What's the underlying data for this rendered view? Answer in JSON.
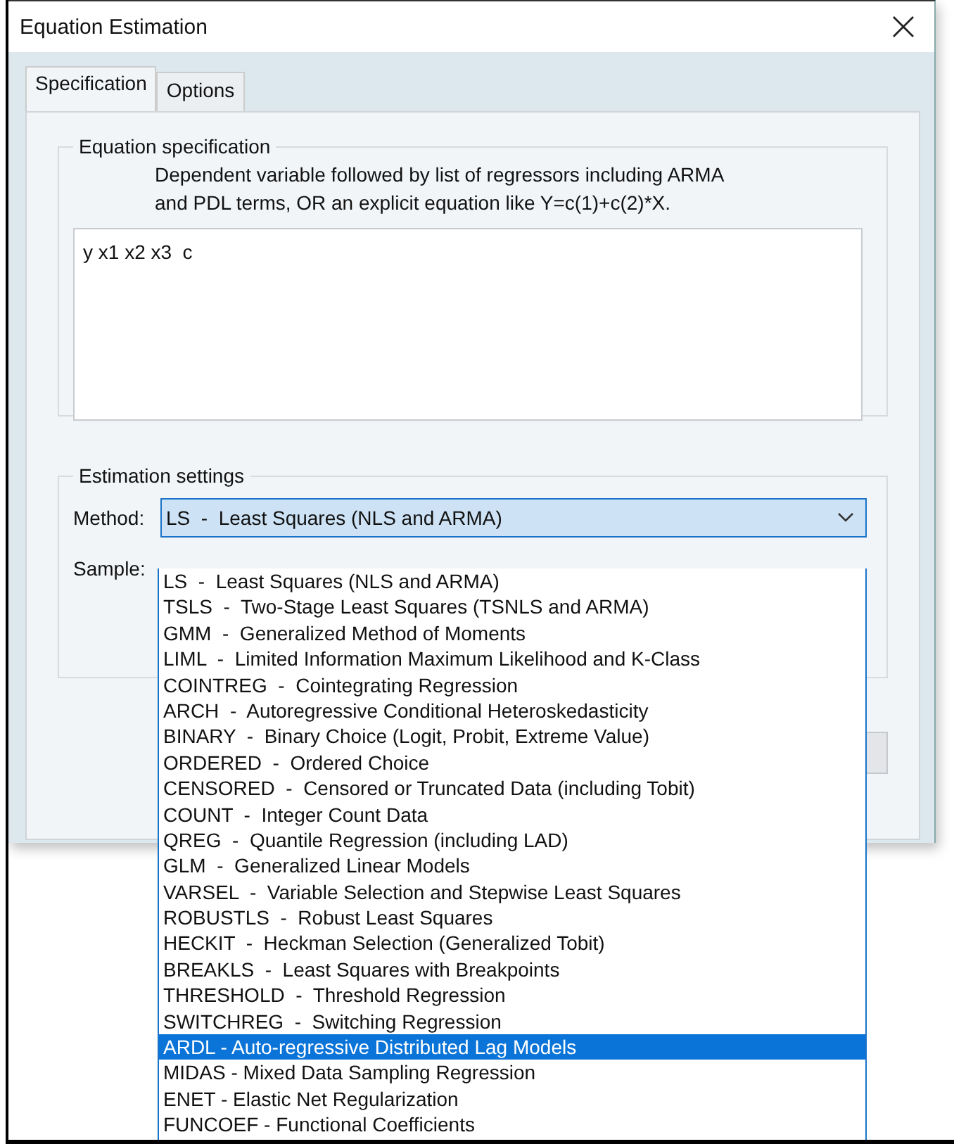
{
  "window": {
    "title": "Equation Estimation"
  },
  "tabs": [
    {
      "label": "Specification",
      "selected": true
    },
    {
      "label": "Options",
      "selected": false
    }
  ],
  "equation_group": {
    "title": "Equation specification",
    "description_lines": [
      "Dependent variable followed by list of regressors including ARMA",
      "and PDL terms, OR an explicit equation like Y=c(1)+c(2)*X."
    ],
    "value": "y x1 x2 x3  c"
  },
  "estimation_group": {
    "title": "Estimation settings",
    "method_label": "Method:",
    "method_value": "LS  -  Least Squares (NLS and ARMA)",
    "sample_label": "Sample:"
  },
  "method_dropdown": {
    "expanded": true,
    "items": [
      {
        "label": "LS  -  Least Squares (NLS and ARMA)",
        "selected": false
      },
      {
        "label": "TSLS  -  Two-Stage Least Squares (TSNLS and ARMA)",
        "selected": false
      },
      {
        "label": "GMM  -  Generalized Method of Moments",
        "selected": false
      },
      {
        "label": "LIML  -  Limited Information Maximum Likelihood and K-Class",
        "selected": false
      },
      {
        "label": "COINTREG  -  Cointegrating Regression",
        "selected": false
      },
      {
        "label": "ARCH  -  Autoregressive Conditional Heteroskedasticity",
        "selected": false
      },
      {
        "label": "BINARY  -  Binary Choice (Logit, Probit, Extreme Value)",
        "selected": false
      },
      {
        "label": "ORDERED  -  Ordered Choice",
        "selected": false
      },
      {
        "label": "CENSORED  -  Censored or Truncated Data (including Tobit)",
        "selected": false
      },
      {
        "label": "COUNT  -  Integer Count Data",
        "selected": false
      },
      {
        "label": "QREG  -  Quantile Regression (including LAD)",
        "selected": false
      },
      {
        "label": "GLM  -  Generalized Linear Models",
        "selected": false
      },
      {
        "label": "VARSEL  -  Variable Selection and Stepwise Least Squares",
        "selected": false
      },
      {
        "label": "ROBUSTLS  -  Robust Least Squares",
        "selected": false
      },
      {
        "label": "HECKIT  -  Heckman Selection (Generalized Tobit)",
        "selected": false
      },
      {
        "label": "BREAKLS  -  Least Squares with Breakpoints",
        "selected": false
      },
      {
        "label": "THRESHOLD  -  Threshold Regression",
        "selected": false
      },
      {
        "label": "SWITCHREG  -  Switching Regression",
        "selected": false
      },
      {
        "label": "ARDL - Auto-regressive Distributed Lag Models",
        "selected": true
      },
      {
        "label": "MIDAS - Mixed Data Sampling Regression",
        "selected": false
      },
      {
        "label": "ENET - Elastic Net Regularization",
        "selected": false
      },
      {
        "label": "FUNCOEF - Functional Coefficients",
        "selected": false
      }
    ]
  }
}
